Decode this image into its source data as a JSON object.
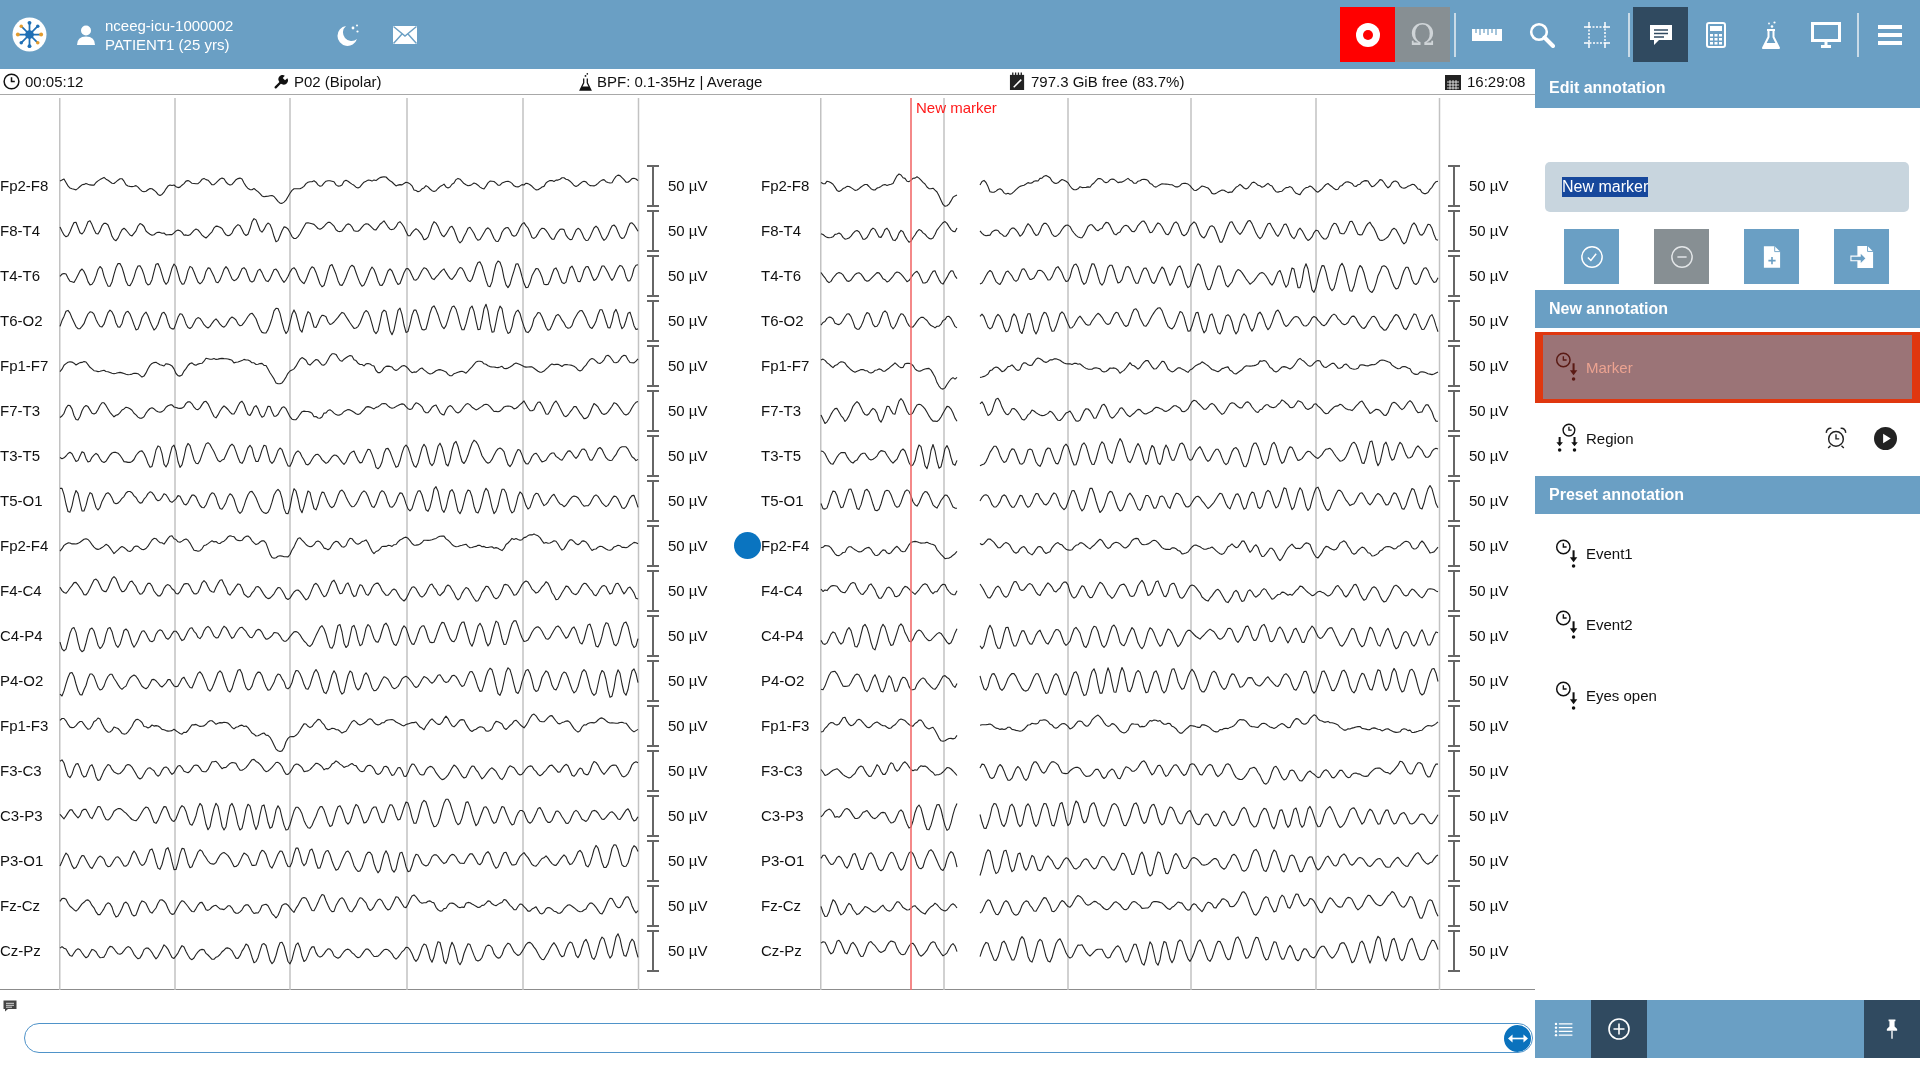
{
  "header": {
    "recording_id": "nceeg-icu-1000002",
    "patient": "PATIENT1 (25 yrs)"
  },
  "toolbar": [
    {
      "items": [
        {
          "kind": "record",
          "selected": false
        },
        {
          "kind": "omega",
          "label": "Ω",
          "selected": false
        }
      ]
    },
    {
      "items": [
        {
          "kind": "ruler",
          "selected": false
        },
        {
          "kind": "search",
          "selected": false
        },
        {
          "kind": "crop",
          "selected": false
        }
      ]
    },
    {
      "items": [
        {
          "kind": "comment",
          "selected": true
        },
        {
          "kind": "calculator",
          "selected": false
        },
        {
          "kind": "flask",
          "selected": false
        },
        {
          "kind": "monitor",
          "selected": false
        }
      ]
    },
    {
      "items": [
        {
          "kind": "menu",
          "selected": false
        }
      ]
    }
  ],
  "status_bar": {
    "elapsed": "00:05:12",
    "montage": "P02 (Bipolar)",
    "filter": "BPF: 0.1-35Hz | Average",
    "disk": "797.3 GiB free (83.7%)",
    "clock": "16:29:08"
  },
  "eeg": {
    "marker": {
      "label": "New marker"
    },
    "pages": [
      {
        "channels": [
          {
            "name": "Fp2-F8",
            "scale": "50 µV",
            "selected": false
          },
          {
            "name": "F8-T4",
            "scale": "50 µV",
            "selected": false
          },
          {
            "name": "T4-T6",
            "scale": "50 µV",
            "selected": false
          },
          {
            "name": "T6-O2",
            "scale": "50 µV",
            "selected": false
          },
          {
            "name": "Fp1-F7",
            "scale": "50 µV",
            "selected": false
          },
          {
            "name": "F7-T3",
            "scale": "50 µV",
            "selected": false
          },
          {
            "name": "T3-T5",
            "scale": "50 µV",
            "selected": false
          },
          {
            "name": "T5-O1",
            "scale": "50 µV",
            "selected": false
          },
          {
            "name": "Fp2-F4",
            "scale": "50 µV",
            "selected": false
          },
          {
            "name": "F4-C4",
            "scale": "50 µV",
            "selected": false
          },
          {
            "name": "C4-P4",
            "scale": "50 µV",
            "selected": false
          },
          {
            "name": "P4-O2",
            "scale": "50 µV",
            "selected": false
          },
          {
            "name": "Fp1-F3",
            "scale": "50 µV",
            "selected": false
          },
          {
            "name": "F3-C3",
            "scale": "50 µV",
            "selected": false
          },
          {
            "name": "C3-P3",
            "scale": "50 µV",
            "selected": false
          },
          {
            "name": "P3-O1",
            "scale": "50 µV",
            "selected": false
          },
          {
            "name": "Fz-Cz",
            "scale": "50 µV",
            "selected": false
          },
          {
            "name": "Cz-Pz",
            "scale": "50 µV",
            "selected": false
          }
        ]
      },
      {
        "channels": [
          {
            "name": "Fp2-F8",
            "scale": "50 µV",
            "selected": false
          },
          {
            "name": "F8-T4",
            "scale": "50 µV",
            "selected": false
          },
          {
            "name": "T4-T6",
            "scale": "50 µV",
            "selected": false
          },
          {
            "name": "T6-O2",
            "scale": "50 µV",
            "selected": false
          },
          {
            "name": "Fp1-F7",
            "scale": "50 µV",
            "selected": false
          },
          {
            "name": "F7-T3",
            "scale": "50 µV",
            "selected": false
          },
          {
            "name": "T3-T5",
            "scale": "50 µV",
            "selected": false
          },
          {
            "name": "T5-O1",
            "scale": "50 µV",
            "selected": false
          },
          {
            "name": "Fp2-F4",
            "scale": "50 µV",
            "selected": true
          },
          {
            "name": "F4-C4",
            "scale": "50 µV",
            "selected": false
          },
          {
            "name": "C4-P4",
            "scale": "50 µV",
            "selected": false
          },
          {
            "name": "P4-O2",
            "scale": "50 µV",
            "selected": false
          },
          {
            "name": "Fp1-F3",
            "scale": "50 µV",
            "selected": false
          },
          {
            "name": "F3-C3",
            "scale": "50 µV",
            "selected": false
          },
          {
            "name": "C3-P3",
            "scale": "50 µV",
            "selected": false
          },
          {
            "name": "P3-O1",
            "scale": "50 µV",
            "selected": false
          },
          {
            "name": "Fz-Cz",
            "scale": "50 µV",
            "selected": false
          },
          {
            "name": "Cz-Pz",
            "scale": "50 µV",
            "selected": false
          }
        ]
      }
    ]
  },
  "annotation_panel": {
    "edit": {
      "title": "Edit annotation",
      "name_value": "New marker",
      "value_highlighted": true,
      "buttons": [
        {
          "kind": "confirm",
          "disabled": false
        },
        {
          "kind": "remove",
          "disabled": true
        },
        {
          "kind": "new",
          "disabled": false
        },
        {
          "kind": "export",
          "disabled": false
        }
      ]
    },
    "new": {
      "title": "New annotation",
      "items": [
        {
          "kind": "marker",
          "label": "Marker",
          "selected": true
        },
        {
          "kind": "region",
          "label": "Region",
          "selected": false
        }
      ]
    },
    "preset": {
      "title": "Preset annotation",
      "items": [
        {
          "label": "Event1"
        },
        {
          "label": "Event2"
        },
        {
          "label": "Eyes open"
        }
      ]
    }
  },
  "bottom_toolbar": [
    {
      "kind": "list",
      "selected": false
    },
    {
      "kind": "add",
      "selected": true
    },
    {
      "kind": "pin",
      "selected": true
    }
  ]
}
